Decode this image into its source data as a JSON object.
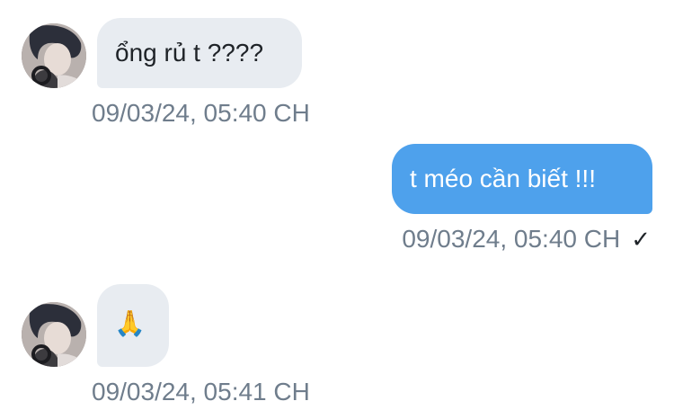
{
  "messages": [
    {
      "direction": "incoming",
      "text": "ổng rủ t ????",
      "timestamp": "09/03/24, 05:40 CH"
    },
    {
      "direction": "outgoing",
      "text": "t méo cần biết !!!",
      "timestamp": "09/03/24, 05:40 CH",
      "status_icon": "✓"
    },
    {
      "direction": "incoming",
      "text": "🙏",
      "timestamp": "09/03/24, 05:41 CH"
    }
  ],
  "colors": {
    "incoming_bubble": "#e8ecf1",
    "outgoing_bubble": "#4ea1ec",
    "timestamp_text": "#6f7d8c"
  },
  "icons": {
    "avatar": "contact-avatar",
    "read_status": "check-icon"
  }
}
